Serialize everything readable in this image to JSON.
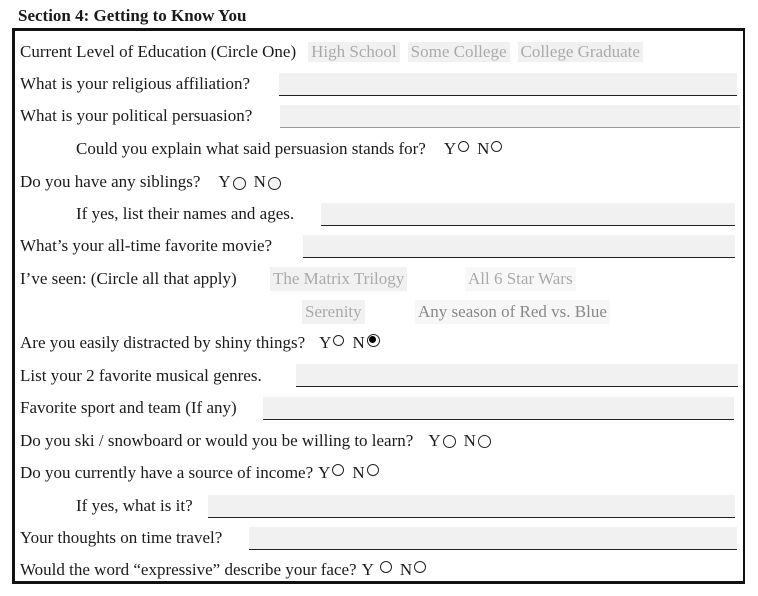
{
  "section_title": "Section 4: Getting to Know You",
  "education": {
    "label": "Current Level of Education (Circle One)",
    "options": [
      "High School",
      "Some College",
      "College Graduate"
    ]
  },
  "religion": {
    "label": "What is your religious affiliation?",
    "value": ""
  },
  "politics": {
    "label": "What is your political persuasion?",
    "value": ""
  },
  "explain_persuasion": {
    "label": "Could you explain what said persuasion stands for?",
    "yes": "Y",
    "no": "N",
    "selected": null
  },
  "siblings": {
    "label": "Do you have any siblings?",
    "yes": "Y",
    "no": "N",
    "selected": null
  },
  "sibling_names": {
    "label": "If yes, list their names and ages.",
    "value": ""
  },
  "favorite_movie": {
    "label": "What’s your all-time favorite movie?",
    "value": ""
  },
  "seen": {
    "label": "I’ve seen: (Circle all that apply)",
    "options": [
      "The Matrix Trilogy",
      "All 6 Star Wars",
      "Serenity",
      "Any season of Red vs. Blue"
    ]
  },
  "shiny": {
    "label": "Are you easily distracted by shiny things?",
    "yes": "Y",
    "no": "N",
    "selected": "N"
  },
  "music": {
    "label": "List your 2 favorite musical genres.",
    "value": ""
  },
  "sport": {
    "label": "Favorite sport and team (If any)",
    "value": ""
  },
  "ski": {
    "label": "Do you ski / snowboard or would you be willing to learn?",
    "yes": "Y",
    "no": "N",
    "selected": null
  },
  "income": {
    "label": "Do you currently have a source of income?",
    "yes": "Y",
    "no": "N",
    "selected": null
  },
  "income_source": {
    "label": "If yes, what is it?",
    "value": ""
  },
  "time_travel": {
    "label": "Your thoughts on time travel?",
    "value": ""
  },
  "expressive": {
    "label": "Would the word “expressive” describe your face?",
    "yes": "Y",
    "no": "N",
    "selected": null
  }
}
